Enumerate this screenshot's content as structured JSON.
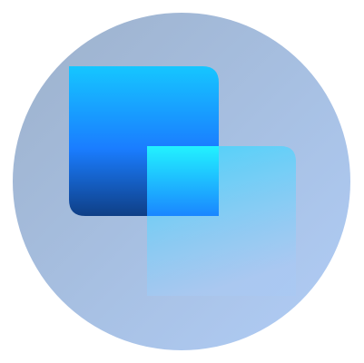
{
  "icon": {
    "name": "overlapping-squares-logo-icon",
    "colors": {
      "circle_top_left": "#9db1cb",
      "circle_bottom_right": "#b0cdf7",
      "front_square_top": "#16c6ff",
      "front_square_mid": "#1a7dff",
      "front_square_bottom": "#0f3f86",
      "overlap_top": "#22f2ff",
      "overlap_bottom": "#1a86ff",
      "back_square_top": "#3ad6ff",
      "back_square_bottom": "#a9c9f3"
    }
  }
}
